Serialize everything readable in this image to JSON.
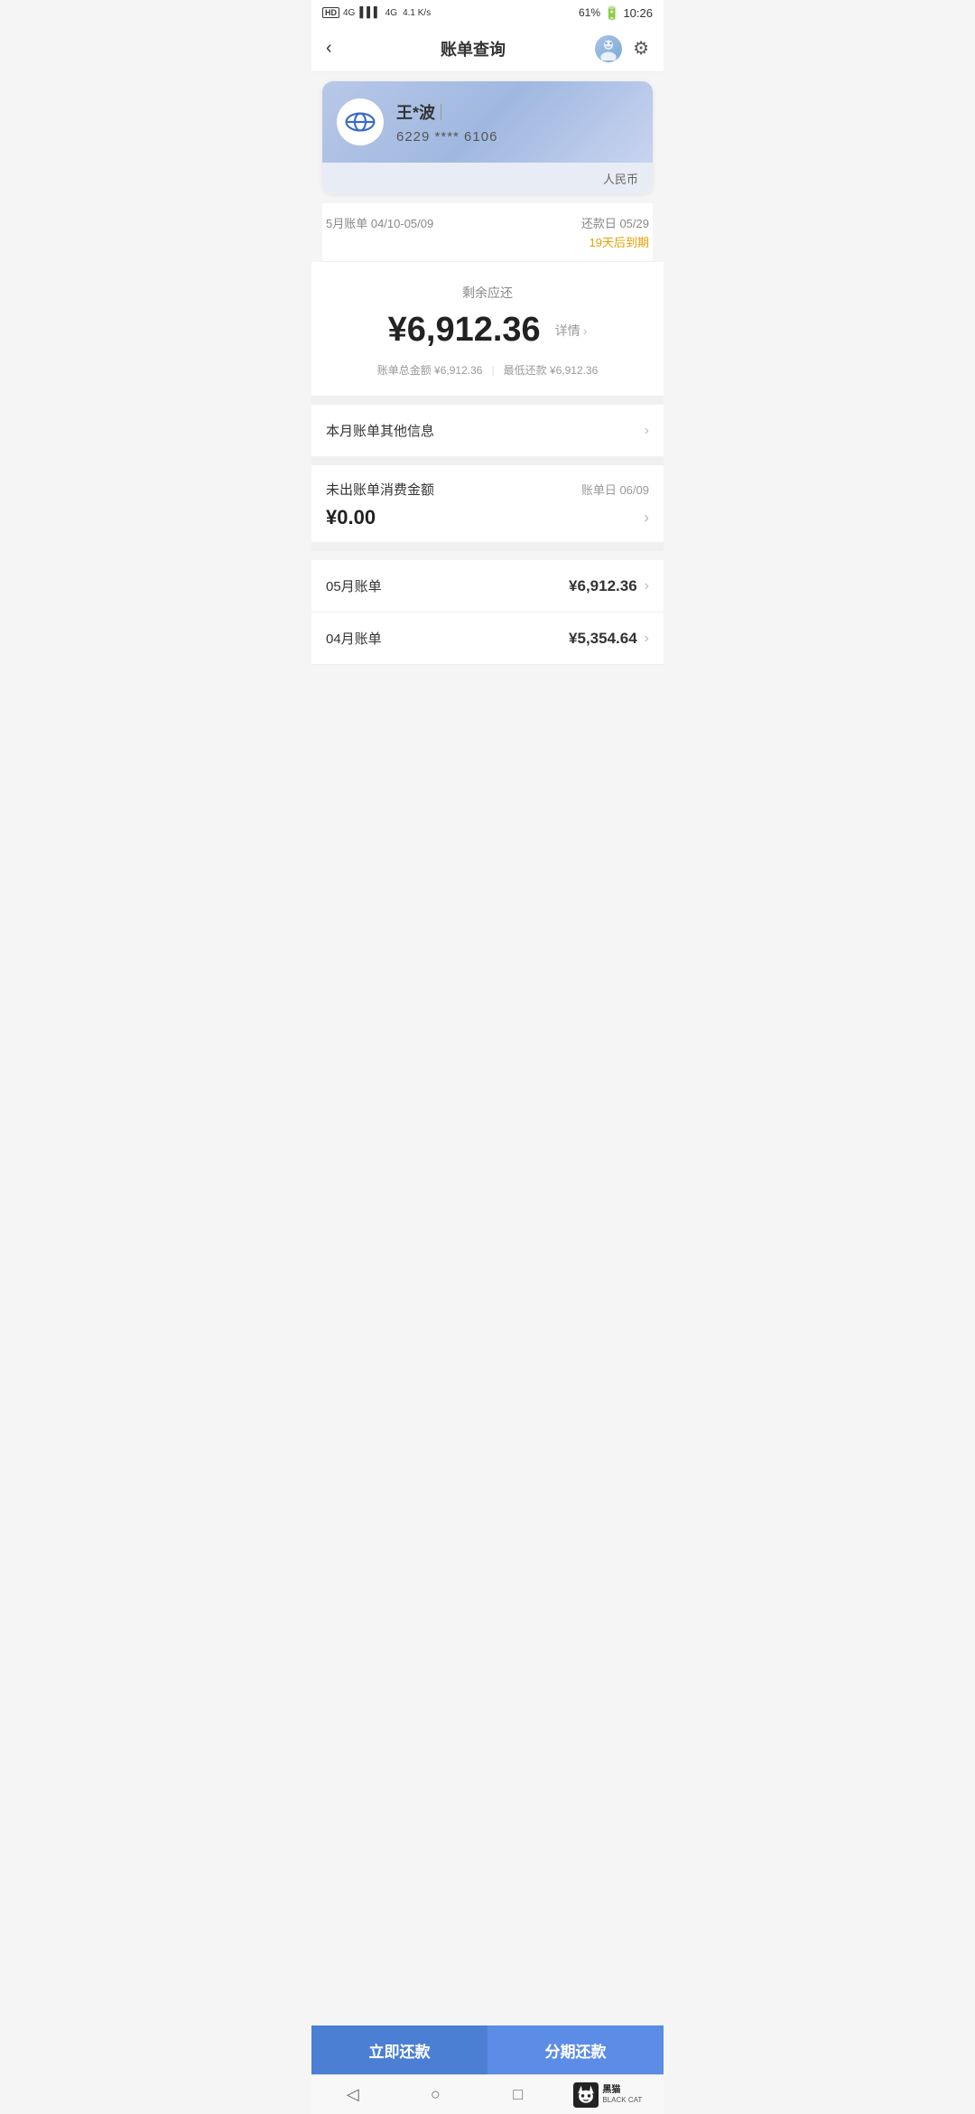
{
  "statusBar": {
    "carrier": "HD 4G | 4G",
    "speed": "4.1 K/s",
    "battery": "61%",
    "time": "10:26"
  },
  "header": {
    "back": "‹",
    "title": "账单查询",
    "avatarIcon": "robot-avatar",
    "gearIcon": "gear-icon"
  },
  "card": {
    "name": "王*波",
    "nameDivider": "|",
    "number": "6229 **** 6106",
    "currency": "人民币"
  },
  "billPeriod": {
    "label": "5月账单 04/10-05/09",
    "dueDateLabel": "还款日 05/29",
    "dueCountdown": "19天后到期"
  },
  "amountSection": {
    "remainingLabel": "剩余应还",
    "amount": "¥6,912.36",
    "detailLabel": "详情",
    "totalLabel": "账单总金额 ¥6,912.36",
    "minPayLabel": "最低还款 ¥6,912.36"
  },
  "otherInfo": {
    "title": "本月账单其他信息"
  },
  "unbilledSection": {
    "title": "未出账单消费金额",
    "billingDateLabel": "账单日 06/09",
    "amount": "¥0.00"
  },
  "monthlyBills": [
    {
      "label": "05月账单",
      "amount": "¥6,912.36"
    },
    {
      "label": "04月账单",
      "amount": "¥5,354.64"
    }
  ],
  "buttons": {
    "repay": "立即还款",
    "installment": "分期还款"
  },
  "bottomNav": {
    "back": "◁",
    "home": "○",
    "recent": "□"
  },
  "blackCat": {
    "label": "黑猫",
    "sublabel": "BLACK CAT"
  }
}
